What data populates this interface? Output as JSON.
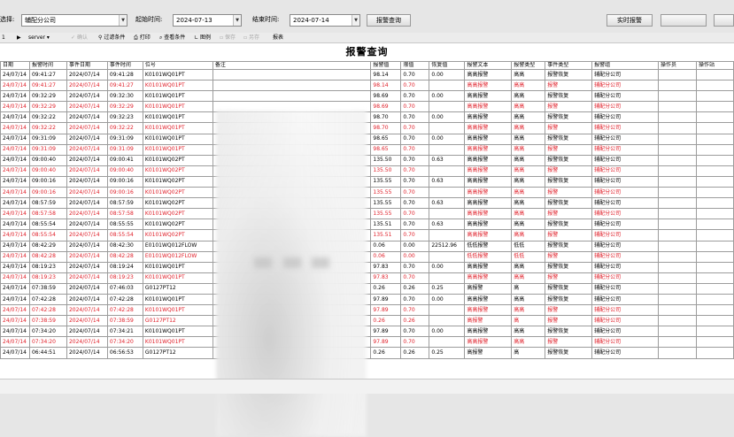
{
  "toolbar": {
    "unit_label": "选择:",
    "unit_value": "辅配分公司",
    "start_label": "起始时间:",
    "start_value": "2024-07-13",
    "end_label": "结束时间:",
    "end_value": "2024-07-14",
    "query_button": "报警查询",
    "realtime_button": "实时报警",
    "dim_button": "",
    "extra_button": ""
  },
  "reportbar": {
    "page": "1",
    "server_value": "server",
    "confirm": "确认",
    "filter": "过滤条件",
    "print": "打印",
    "query_cond": "查看条件",
    "chart": "图例",
    "save": "保存",
    "save_as": "另存",
    "report": "报表"
  },
  "report": {
    "title": "报警查询",
    "columns": [
      "日期",
      "报警时间",
      "事件日期",
      "事件时间",
      "位号",
      "备注",
      "报警值",
      "限值",
      "恢复值",
      "报警文本",
      "报警类型",
      "事件类型",
      "报警组",
      "操作员",
      "操作站"
    ],
    "rows": [
      {
        "red": false,
        "cells": [
          "24/07/14",
          "09:41:27",
          "2024/07/14",
          "09:41:28",
          "K0101WQ01PT",
          "",
          "98.14",
          "0.70",
          "0.00",
          "高高报警",
          "高高",
          "报警恢复",
          "辅配分公司",
          "",
          ""
        ]
      },
      {
        "red": true,
        "cells": [
          "24/07/14",
          "09:41:27",
          "2024/07/14",
          "09:41:27",
          "K0101WQ01PT",
          "",
          "98.14",
          "0.70",
          "",
          "高高报警",
          "高高",
          "报警",
          "辅配分公司",
          "",
          ""
        ]
      },
      {
        "red": false,
        "cells": [
          "24/07/14",
          "09:32:29",
          "2024/07/14",
          "09:32:30",
          "K0101WQ01PT",
          "",
          "98.69",
          "0.70",
          "0.00",
          "高高报警",
          "高高",
          "报警恢复",
          "辅配分公司",
          "",
          ""
        ]
      },
      {
        "red": true,
        "cells": [
          "24/07/14",
          "09:32:29",
          "2024/07/14",
          "09:32:29",
          "K0101WQ01PT",
          "",
          "98.69",
          "0.70",
          "",
          "高高报警",
          "高高",
          "报警",
          "辅配分公司",
          "",
          ""
        ]
      },
      {
        "red": false,
        "cells": [
          "24/07/14",
          "09:32:22",
          "2024/07/14",
          "09:32:23",
          "K0101WQ01PT",
          "",
          "98.70",
          "0.70",
          "0.00",
          "高高报警",
          "高高",
          "报警恢复",
          "辅配分公司",
          "",
          ""
        ]
      },
      {
        "red": true,
        "cells": [
          "24/07/14",
          "09:32:22",
          "2024/07/14",
          "09:32:22",
          "K0101WQ01PT",
          "",
          "98.70",
          "0.70",
          "",
          "高高报警",
          "高高",
          "报警",
          "辅配分公司",
          "",
          ""
        ]
      },
      {
        "red": false,
        "cells": [
          "24/07/14",
          "09:31:09",
          "2024/07/14",
          "09:31:09",
          "K0101WQ01PT",
          "",
          "98.65",
          "0.70",
          "0.00",
          "高高报警",
          "高高",
          "报警恢复",
          "辅配分公司",
          "",
          ""
        ]
      },
      {
        "red": true,
        "cells": [
          "24/07/14",
          "09:31:09",
          "2024/07/14",
          "09:31:09",
          "K0101WQ01PT",
          "",
          "98.65",
          "0.70",
          "",
          "高高报警",
          "高高",
          "报警",
          "辅配分公司",
          "",
          ""
        ]
      },
      {
        "red": false,
        "cells": [
          "24/07/14",
          "09:00:40",
          "2024/07/14",
          "09:00:41",
          "K0101WQ02PT",
          "",
          "135.50",
          "0.70",
          "0.63",
          "高高报警",
          "高高",
          "报警恢复",
          "辅配分公司",
          "",
          ""
        ]
      },
      {
        "red": true,
        "cells": [
          "24/07/14",
          "09:00:40",
          "2024/07/14",
          "09:00:40",
          "K0101WQ02PT",
          "",
          "135.50",
          "0.70",
          "",
          "高高报警",
          "高高",
          "报警",
          "辅配分公司",
          "",
          ""
        ]
      },
      {
        "red": false,
        "cells": [
          "24/07/14",
          "09:00:16",
          "2024/07/14",
          "09:00:16",
          "K0101WQ02PT",
          "",
          "135.55",
          "0.70",
          "0.63",
          "高高报警",
          "高高",
          "报警恢复",
          "辅配分公司",
          "",
          ""
        ]
      },
      {
        "red": true,
        "cells": [
          "24/07/14",
          "09:00:16",
          "2024/07/14",
          "09:00:16",
          "K0101WQ02PT",
          "",
          "135.55",
          "0.70",
          "",
          "高高报警",
          "高高",
          "报警",
          "辅配分公司",
          "",
          ""
        ]
      },
      {
        "red": false,
        "cells": [
          "24/07/14",
          "08:57:59",
          "2024/07/14",
          "08:57:59",
          "K0101WQ02PT",
          "",
          "135.55",
          "0.70",
          "0.63",
          "高高报警",
          "高高",
          "报警恢复",
          "辅配分公司",
          "",
          ""
        ]
      },
      {
        "red": true,
        "cells": [
          "24/07/14",
          "08:57:58",
          "2024/07/14",
          "08:57:58",
          "K0101WQ02PT",
          "",
          "135.55",
          "0.70",
          "",
          "高高报警",
          "高高",
          "报警",
          "辅配分公司",
          "",
          ""
        ]
      },
      {
        "red": false,
        "cells": [
          "24/07/14",
          "08:55:54",
          "2024/07/14",
          "08:55:55",
          "K0101WQ02PT",
          "",
          "135.51",
          "0.70",
          "0.63",
          "高高报警",
          "高高",
          "报警恢复",
          "辅配分公司",
          "",
          ""
        ]
      },
      {
        "red": true,
        "cells": [
          "24/07/14",
          "08:55:54",
          "2024/07/14",
          "08:55:54",
          "K0101WQ02PT",
          "",
          "135.51",
          "0.70",
          "",
          "高高报警",
          "高高",
          "报警",
          "辅配分公司",
          "",
          ""
        ]
      },
      {
        "red": false,
        "cells": [
          "24/07/14",
          "08:42:29",
          "2024/07/14",
          "08:42:30",
          "E0101WQ012FLOW",
          "",
          "0.06",
          "0.00",
          "22512.96",
          "低低报警",
          "低低",
          "报警恢复",
          "辅配分公司",
          "",
          ""
        ]
      },
      {
        "red": true,
        "cells": [
          "24/07/14",
          "08:42:28",
          "2024/07/14",
          "08:42:28",
          "E0101WQ012FLOW",
          "",
          "0.06",
          "0.00",
          "",
          "低低报警",
          "低低",
          "报警",
          "辅配分公司",
          "",
          ""
        ]
      },
      {
        "red": false,
        "cells": [
          "24/07/14",
          "08:19:23",
          "2024/07/14",
          "08:19:24",
          "K0101WQ01PT",
          "",
          "97.83",
          "0.70",
          "0.00",
          "高高报警",
          "高高",
          "报警恢复",
          "辅配分公司",
          "",
          ""
        ]
      },
      {
        "red": true,
        "cells": [
          "24/07/14",
          "08:19:23",
          "2024/07/14",
          "08:19:23",
          "K0101WQ01PT",
          "",
          "97.83",
          "0.70",
          "",
          "高高报警",
          "高高",
          "报警",
          "辅配分公司",
          "",
          ""
        ]
      },
      {
        "red": false,
        "cells": [
          "24/07/14",
          "07:38:59",
          "2024/07/14",
          "07:46:03",
          "G0127PT12",
          "",
          "0.26",
          "0.26",
          "0.25",
          "高报警",
          "高",
          "报警恢复",
          "辅配分公司",
          "",
          ""
        ]
      },
      {
        "red": false,
        "cells": [
          "24/07/14",
          "07:42:28",
          "2024/07/14",
          "07:42:28",
          "K0101WQ01PT",
          "",
          "97.89",
          "0.70",
          "0.00",
          "高高报警",
          "高高",
          "报警恢复",
          "辅配分公司",
          "",
          ""
        ]
      },
      {
        "red": true,
        "cells": [
          "24/07/14",
          "07:42:28",
          "2024/07/14",
          "07:42:28",
          "K0101WQ01PT",
          "",
          "97.89",
          "0.70",
          "",
          "高高报警",
          "高高",
          "报警",
          "辅配分公司",
          "",
          ""
        ]
      },
      {
        "red": true,
        "cells": [
          "24/07/14",
          "07:38:59",
          "2024/07/14",
          "07:38:59",
          "G0127PT12",
          "",
          "0.26",
          "0.26",
          "",
          "高报警",
          "高",
          "报警",
          "辅配分公司",
          "",
          ""
        ]
      },
      {
        "red": false,
        "cells": [
          "24/07/14",
          "07:34:20",
          "2024/07/14",
          "07:34:21",
          "K0101WQ01PT",
          "",
          "97.89",
          "0.70",
          "0.00",
          "高高报警",
          "高高",
          "报警恢复",
          "辅配分公司",
          "",
          ""
        ]
      },
      {
        "red": true,
        "cells": [
          "24/07/14",
          "07:34:20",
          "2024/07/14",
          "07:34:20",
          "K0101WQ01PT",
          "",
          "97.89",
          "0.70",
          "",
          "高高报警",
          "高高",
          "报警",
          "辅配分公司",
          "",
          ""
        ]
      },
      {
        "red": false,
        "cells": [
          "24/07/14",
          "06:44:51",
          "2024/07/14",
          "06:56:53",
          "G0127PT12",
          "",
          "0.26",
          "0.26",
          "0.25",
          "高报警",
          "高",
          "报警恢复",
          "辅配分公司",
          "",
          ""
        ]
      }
    ]
  }
}
